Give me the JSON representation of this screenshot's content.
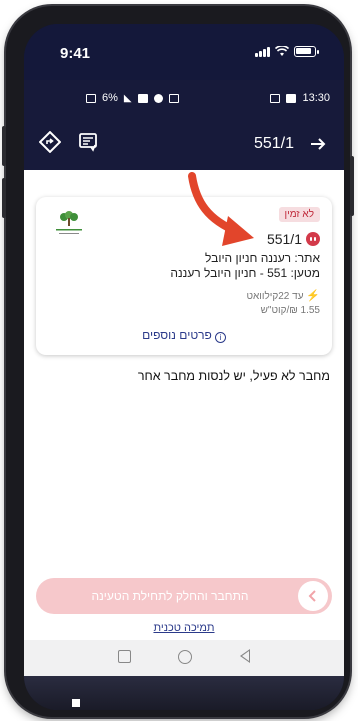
{
  "ios_status": {
    "time": "9:41"
  },
  "android_status": {
    "battery": "6%",
    "time": "13:30"
  },
  "appbar": {
    "title": "551/1"
  },
  "card": {
    "status_badge": "לא זמין",
    "charger_id": "551/1",
    "site_line": "אתר: רעננה חניון היובל",
    "charger_line": "מטען: 551 -  חניון היובל רעננה",
    "power": "עד 22קילוואט",
    "price": "1.55 ₪/קוט\"ש",
    "details_link": "פרטים נוספים"
  },
  "message": "מחבר לא פעיל, יש לנסות מחבר אחר",
  "slider": {
    "label": "התחבר והחלק לתחילת הטעינה"
  },
  "support_link": "תמיכה טכנית",
  "colors": {
    "navy": "#171a3a",
    "accent_red": "#d33a4a",
    "slider_bg": "#f6c8cb",
    "link": "#2b3a8a"
  }
}
